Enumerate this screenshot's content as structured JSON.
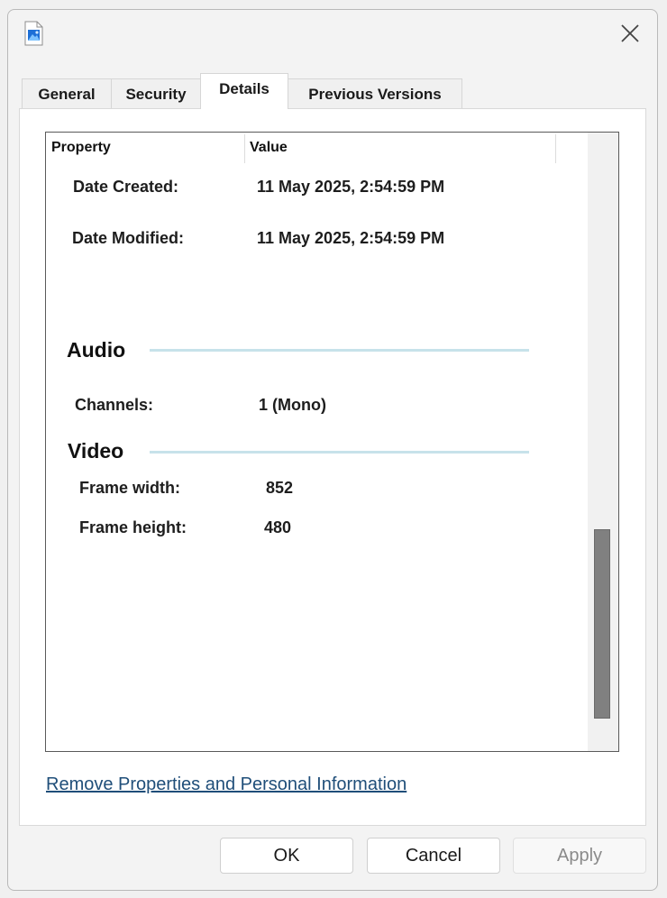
{
  "tabs": [
    {
      "label": "General",
      "active": false
    },
    {
      "label": "Security",
      "active": false
    },
    {
      "label": "Details",
      "active": true
    },
    {
      "label": "Previous Versions",
      "active": false
    }
  ],
  "columns": {
    "property": "Property",
    "value": "Value"
  },
  "rows": {
    "date_created": {
      "label": "Date Created:",
      "value": "11 May 2025, 2:54:59 PM"
    },
    "date_modified": {
      "label": "Date Modified:",
      "value": "11 May 2025, 2:54:59 PM"
    },
    "channels": {
      "label": "Channels:",
      "value": "1 (Mono)"
    },
    "frame_width": {
      "label": "Frame width:",
      "value": "852"
    },
    "frame_height": {
      "label": "Frame height:",
      "value": "480"
    }
  },
  "sections": {
    "audio": "Audio",
    "video": "Video"
  },
  "link": {
    "remove_properties": "Remove Properties and Personal Information"
  },
  "buttons": {
    "ok": "OK",
    "cancel": "Cancel",
    "apply": "Apply"
  },
  "icons": {
    "file": "image-file-icon",
    "close": "close-icon"
  },
  "colors": {
    "link": "#1f4e79",
    "section_line": "#c7e2ea",
    "scroll_thumb": "#808080"
  }
}
